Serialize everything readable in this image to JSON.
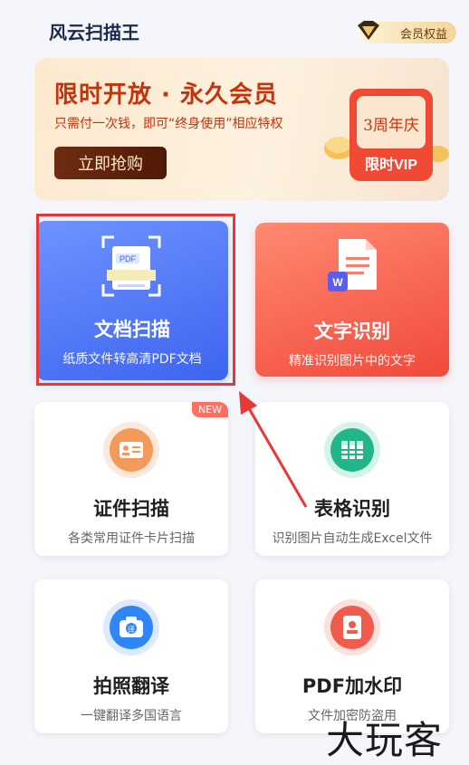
{
  "app": {
    "title": "风云扫描王",
    "member_label": "会员权益"
  },
  "banner": {
    "title": "限时开放 · 永久会员",
    "subtitle": "只需付一次钱，即可“终身使用”相应特权",
    "button": "立即抢购",
    "badge_top": "3周年庆",
    "badge_bottom": "限时VIP"
  },
  "features": [
    {
      "title": "文档扫描",
      "subtitle": "纸质文件转高清PDF文档",
      "icon_text": "PDF"
    },
    {
      "title": "文字识别",
      "subtitle": "精准识别图片中的文字",
      "icon_text": "W"
    },
    {
      "title": "证件扫描",
      "subtitle": "各类常用证件卡片扫描",
      "badge": "NEW"
    },
    {
      "title": "表格识别",
      "subtitle": "识别图片自动生成Excel文件"
    },
    {
      "title": "拍照翻译",
      "subtitle": "一键翻译多国语言",
      "icon_text": "译"
    },
    {
      "title": "PDF加水印",
      "subtitle": "文件加密防盗用"
    }
  ],
  "watermark": "大玩客",
  "colors": {
    "doc_card": "#3c64f0",
    "text_card": "#f1493a",
    "highlight": "#e53935",
    "banner_text": "#c2350c"
  }
}
